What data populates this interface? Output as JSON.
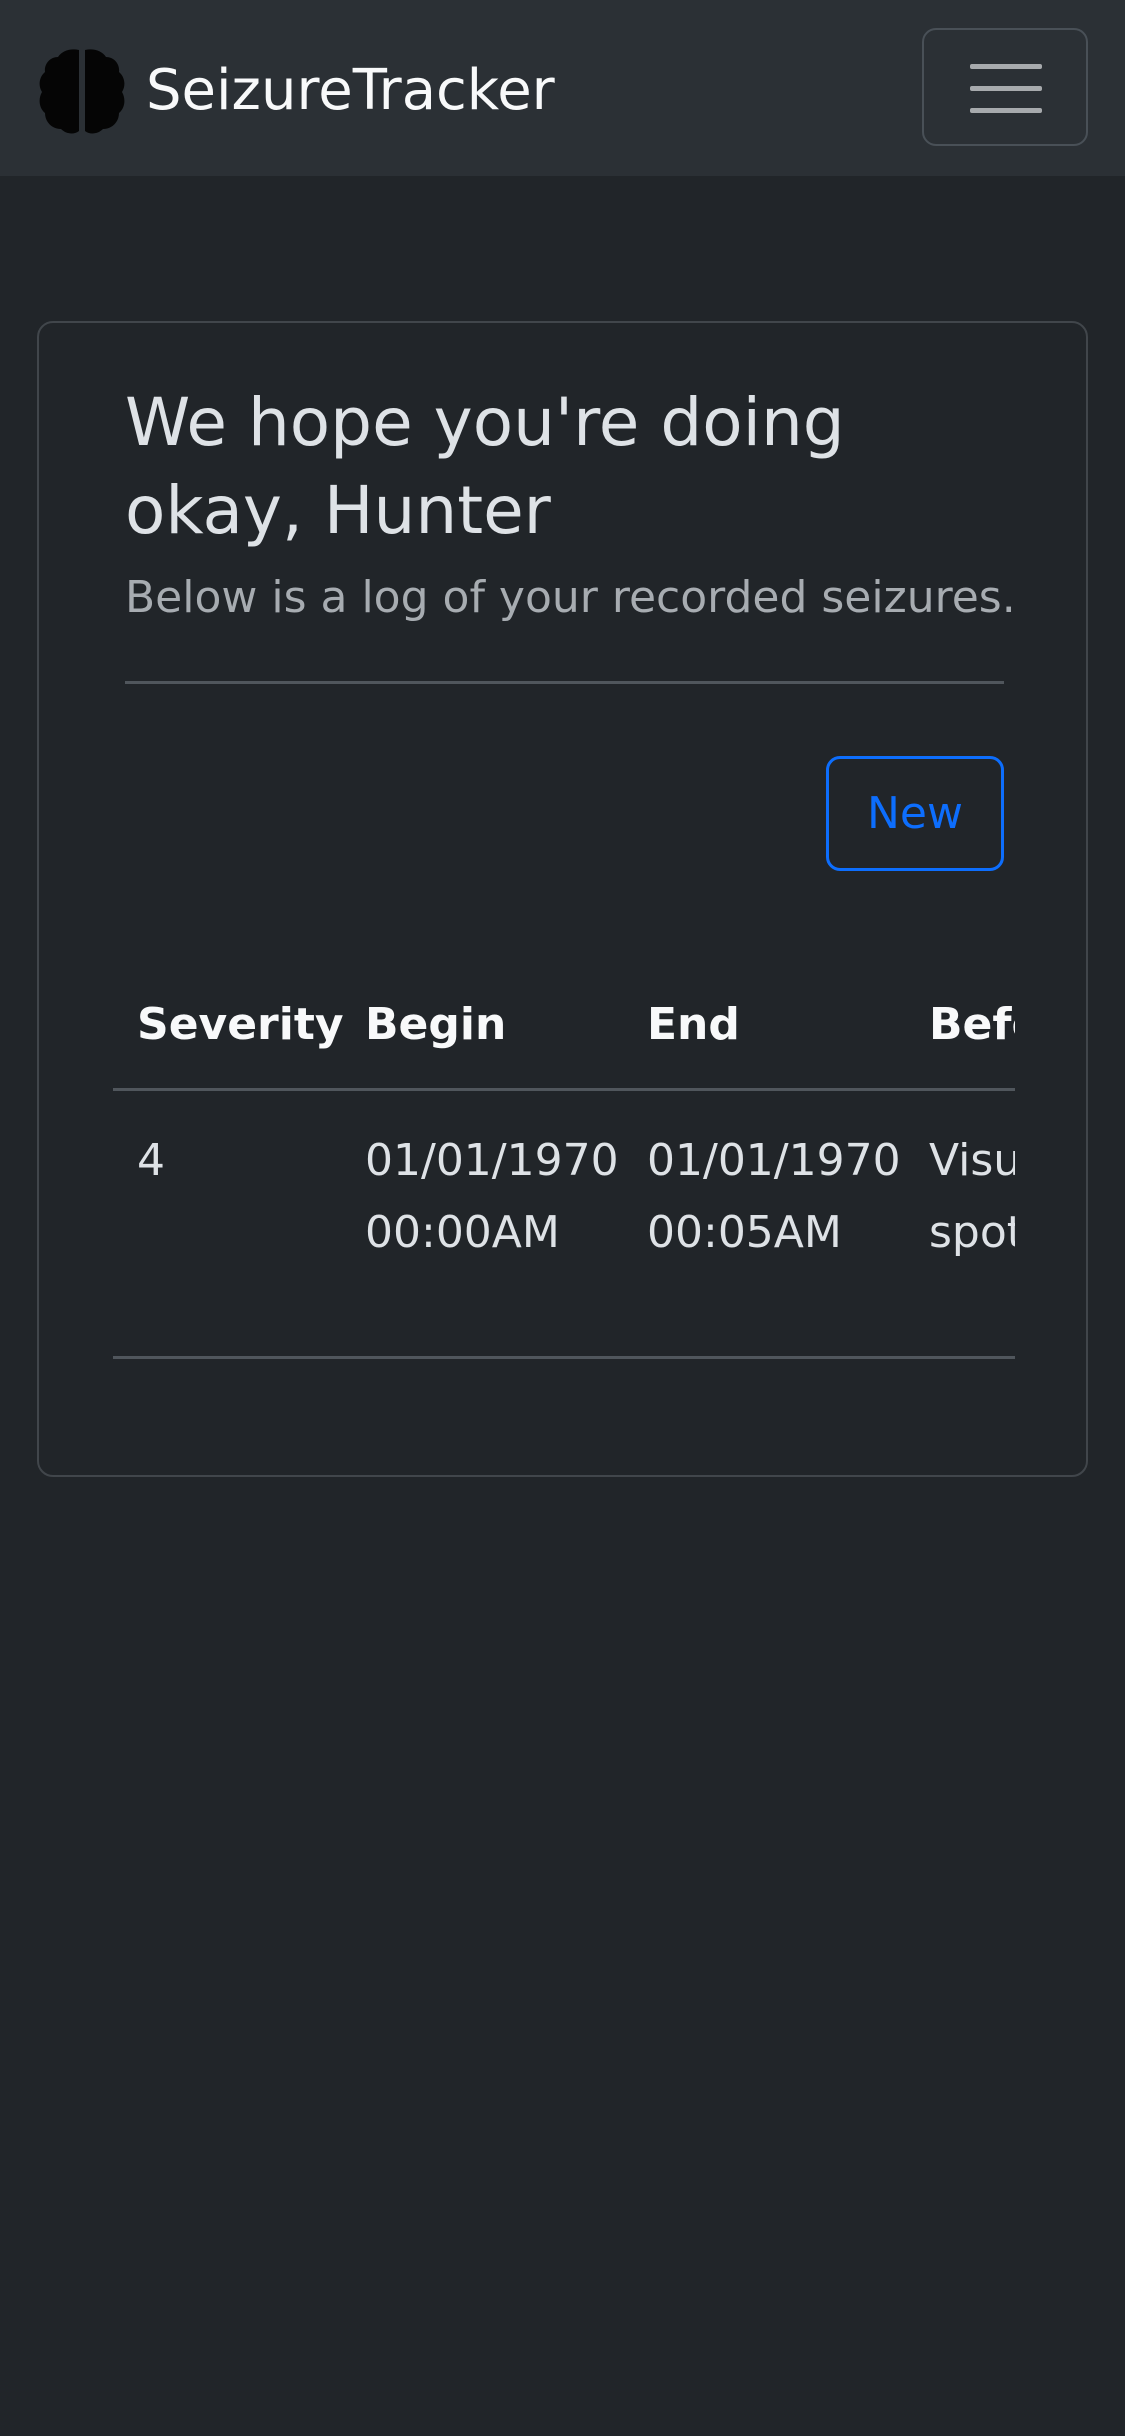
{
  "navbar": {
    "brand_name": "SeizureTracker",
    "logo_icon": "brain-icon",
    "menu_icon": "hamburger-menu-icon"
  },
  "card": {
    "greeting": "We hope you're doing okay, Hunter",
    "subtitle": "Below is a log of your recorded seizures.",
    "new_button_label": "New"
  },
  "table": {
    "columns": [
      "Severity",
      "Begin",
      "End",
      "Before Notes"
    ],
    "rows": [
      {
        "severity": "4",
        "begin": "01/01/1970 00:00AM",
        "end": "01/01/1970 00:05AM",
        "before_notes": "Visual aura spots"
      }
    ]
  },
  "colors": {
    "background": "#212529",
    "navbar": "#2b3035",
    "accent": "#0d6efd"
  }
}
